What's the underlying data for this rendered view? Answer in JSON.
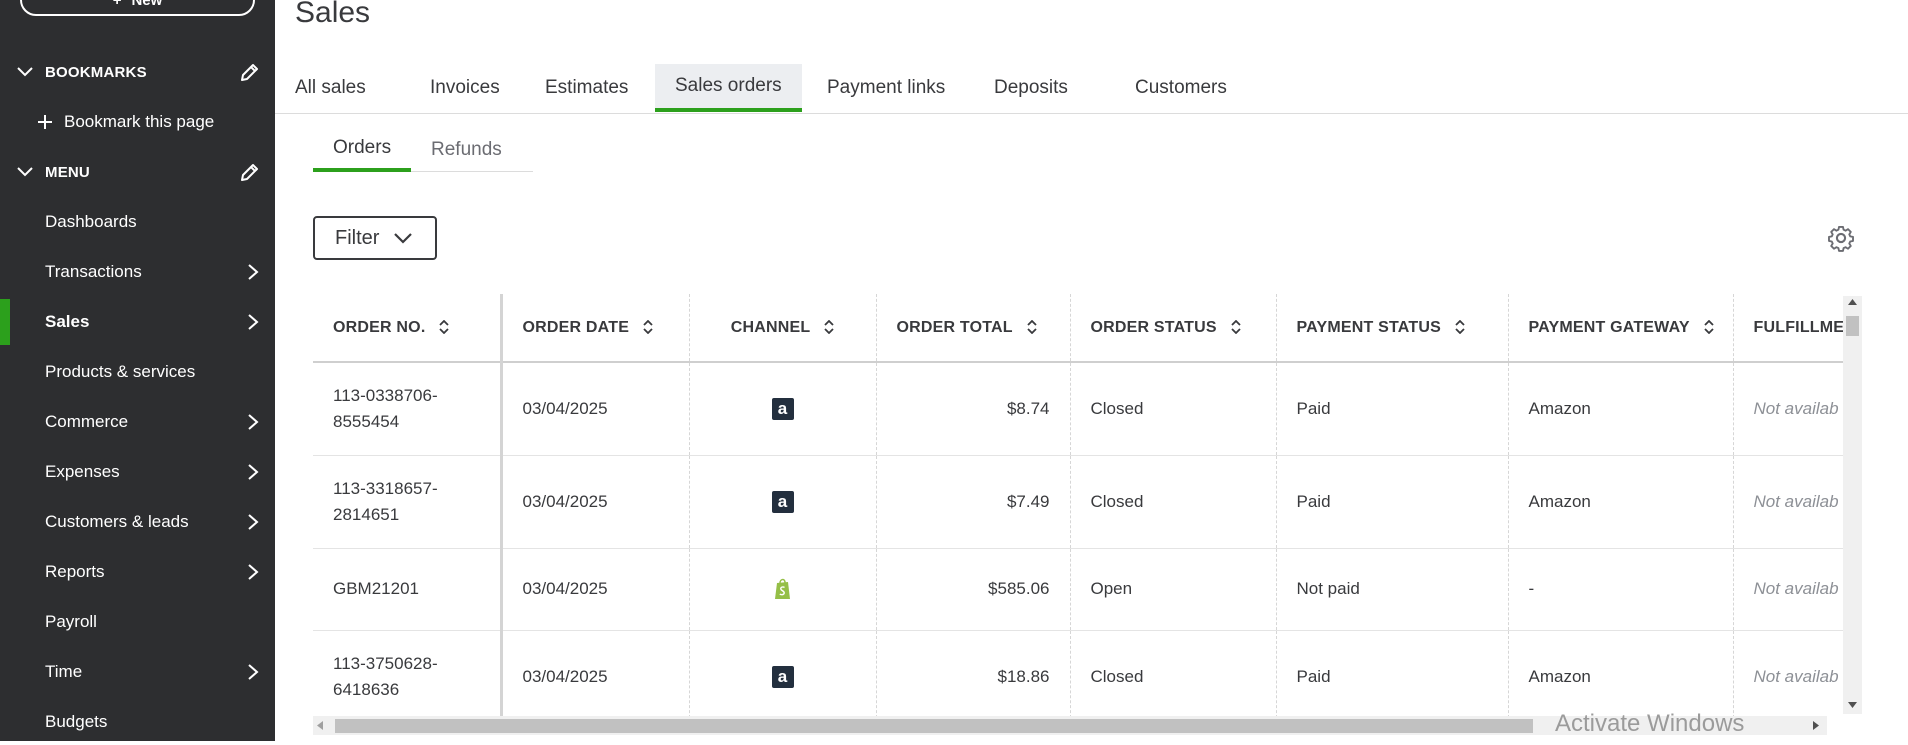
{
  "sidebar": {
    "new_label": "New",
    "bookmarks_title": "BOOKMARKS",
    "bookmark_add": "Bookmark this page",
    "menu_title": "MENU",
    "items": [
      {
        "label": "Dashboards",
        "has_arrow": false
      },
      {
        "label": "Transactions",
        "has_arrow": true
      },
      {
        "label": "Sales",
        "has_arrow": true,
        "active": true
      },
      {
        "label": "Products & services",
        "has_arrow": false
      },
      {
        "label": "Commerce",
        "has_arrow": true
      },
      {
        "label": "Expenses",
        "has_arrow": true
      },
      {
        "label": "Customers & leads",
        "has_arrow": true
      },
      {
        "label": "Reports",
        "has_arrow": true
      },
      {
        "label": "Payroll",
        "has_arrow": false
      },
      {
        "label": "Time",
        "has_arrow": true
      },
      {
        "label": "Budgets",
        "has_arrow": false
      }
    ]
  },
  "page": {
    "title": "Sales",
    "tabs": [
      "All sales",
      "Invoices",
      "Estimates",
      "Sales orders",
      "Payment links",
      "Deposits",
      "Customers"
    ],
    "active_tab": "Sales orders",
    "subtabs": [
      "Orders",
      "Refunds"
    ],
    "active_subtab": "Orders",
    "filter_label": "Filter"
  },
  "table": {
    "columns": [
      "ORDER NO.",
      "ORDER DATE",
      "CHANNEL",
      "ORDER TOTAL",
      "ORDER STATUS",
      "PAYMENT STATUS",
      "PAYMENT GATEWAY",
      "FULFILLME"
    ],
    "rows": [
      {
        "order_no": "113-0338706-8555454",
        "order_no_l1": "113-0338706-",
        "order_no_l2": "8555454",
        "date": "03/04/2025",
        "channel": "amazon",
        "channel_glyph": "a",
        "total": "$8.74",
        "status": "Closed",
        "payment": "Paid",
        "gateway": "Amazon",
        "fulfillment": "Not availab"
      },
      {
        "order_no": "113-3318657-2814651",
        "order_no_l1": "113-3318657-",
        "order_no_l2": "2814651",
        "date": "03/04/2025",
        "channel": "amazon",
        "channel_glyph": "a",
        "total": "$7.49",
        "status": "Closed",
        "payment": "Paid",
        "gateway": "Amazon",
        "fulfillment": "Not availab"
      },
      {
        "order_no": "GBM21201",
        "order_no_l1": "GBM21201",
        "order_no_l2": "",
        "date": "03/04/2025",
        "channel": "shopify",
        "channel_glyph": "",
        "total": "$585.06",
        "status": "Open",
        "payment": "Not paid",
        "gateway": "-",
        "fulfillment": "Not availab"
      },
      {
        "order_no": "113-3750628-6418636",
        "order_no_l1": "113-3750628-",
        "order_no_l2": "6418636",
        "date": "03/04/2025",
        "channel": "amazon",
        "channel_glyph": "a",
        "total": "$18.86",
        "status": "Closed",
        "payment": "Paid",
        "gateway": "Amazon",
        "fulfillment": "Not availab"
      }
    ]
  },
  "watermark": "Activate Windows",
  "colors": {
    "sidebar_bg": "#2d2e30",
    "accent": "#2ca01c",
    "amazon_bg": "#232f3e",
    "shopify": "#95bf47"
  }
}
